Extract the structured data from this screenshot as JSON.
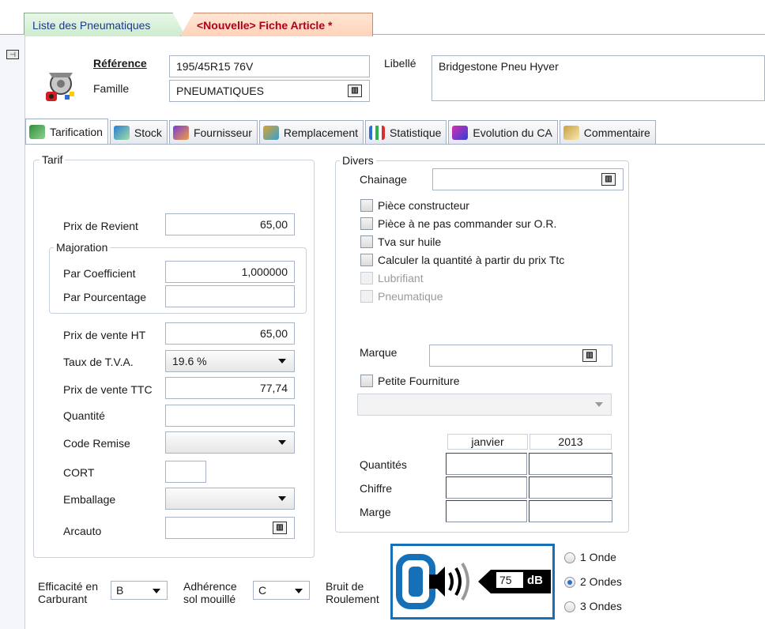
{
  "doc_tabs": [
    {
      "label": "Liste des Pneumatiques"
    },
    {
      "label": "<Nouvelle> Fiche Article *"
    }
  ],
  "header": {
    "reference_label": "Référence",
    "reference_value": "195/45R15 76V",
    "famille_label": "Famille",
    "famille_value": "PNEUMATIQUES",
    "libelle_label": "Libellé",
    "libelle_value": "Bridgestone Pneu Hyver"
  },
  "tabs": [
    {
      "label": "Tarification",
      "icon": "price-icon"
    },
    {
      "label": "Stock",
      "icon": "stock-icon"
    },
    {
      "label": "Fournisseur",
      "icon": "supplier-icon"
    },
    {
      "label": "Remplacement",
      "icon": "replace-icon"
    },
    {
      "label": "Statistique",
      "icon": "chart-icon"
    },
    {
      "label": "Evolution du CA",
      "icon": "evolution-icon"
    },
    {
      "label": "Commentaire",
      "icon": "comment-icon"
    }
  ],
  "tarif": {
    "title": "Tarif",
    "prix_revient_label": "Prix de Revient",
    "prix_revient_value": "65,00",
    "majoration_title": "Majoration",
    "par_coefficient_label": "Par Coefficient",
    "par_coefficient_value": "1,000000",
    "par_pourcentage_label": "Par Pourcentage",
    "par_pourcentage_value": "",
    "prix_vente_ht_label": "Prix de vente HT",
    "prix_vente_ht_value": "65,00",
    "taux_tva_label": "Taux de T.V.A.",
    "taux_tva_value": "19.6 %",
    "prix_vente_ttc_label": "Prix de vente TTC",
    "prix_vente_ttc_value": "77,74",
    "quantite_label": "Quantité",
    "quantite_value": "",
    "code_remise_label": "Code Remise",
    "code_remise_value": "",
    "cort_label": "CORT",
    "cort_value": "",
    "emballage_label": "Emballage",
    "emballage_value": "",
    "arcauto_label": "Arcauto",
    "arcauto_value": ""
  },
  "divers": {
    "title": "Divers",
    "chainage_label": "Chainage",
    "chainage_value": "",
    "checkboxes": [
      {
        "label": "Pièce constructeur",
        "checked": false,
        "disabled": false
      },
      {
        "label": "Pièce à ne pas commander sur O.R.",
        "checked": false,
        "disabled": false
      },
      {
        "label": "Tva sur huile",
        "checked": false,
        "disabled": false
      },
      {
        "label": "Calculer la quantité à partir du prix Ttc",
        "checked": false,
        "disabled": false
      },
      {
        "label": "Lubrifiant",
        "checked": false,
        "disabled": true
      },
      {
        "label": "Pneumatique",
        "checked": false,
        "disabled": true
      }
    ],
    "marque_label": "Marque",
    "marque_value": "",
    "petite_fourniture_label": "Petite Fourniture",
    "petite_fourniture_select": "",
    "stats_headers": [
      "janvier",
      "2013"
    ],
    "stats_rows": [
      "Quantités",
      "Chiffre",
      "Marge"
    ]
  },
  "eu_label": {
    "efficacite_label_1": "Efficacité en",
    "efficacite_label_2": "Carburant",
    "efficacite_value": "B",
    "adherence_label_1": "Adhérence",
    "adherence_label_2": "sol mouillé",
    "adherence_value": "C",
    "bruit_label_1": "Bruit de",
    "bruit_label_2": "Roulement",
    "bruit_db_value": "75",
    "bruit_db_unit": "dB",
    "ondes": [
      {
        "label": "1 Onde",
        "selected": false
      },
      {
        "label": "2 Ondes",
        "selected": true
      },
      {
        "label": "3 Ondes",
        "selected": false
      }
    ]
  },
  "colors": {
    "accent": "#2b6ed6",
    "eu_badge": "#1570b8",
    "doctab_active_text": "#b0001a"
  }
}
